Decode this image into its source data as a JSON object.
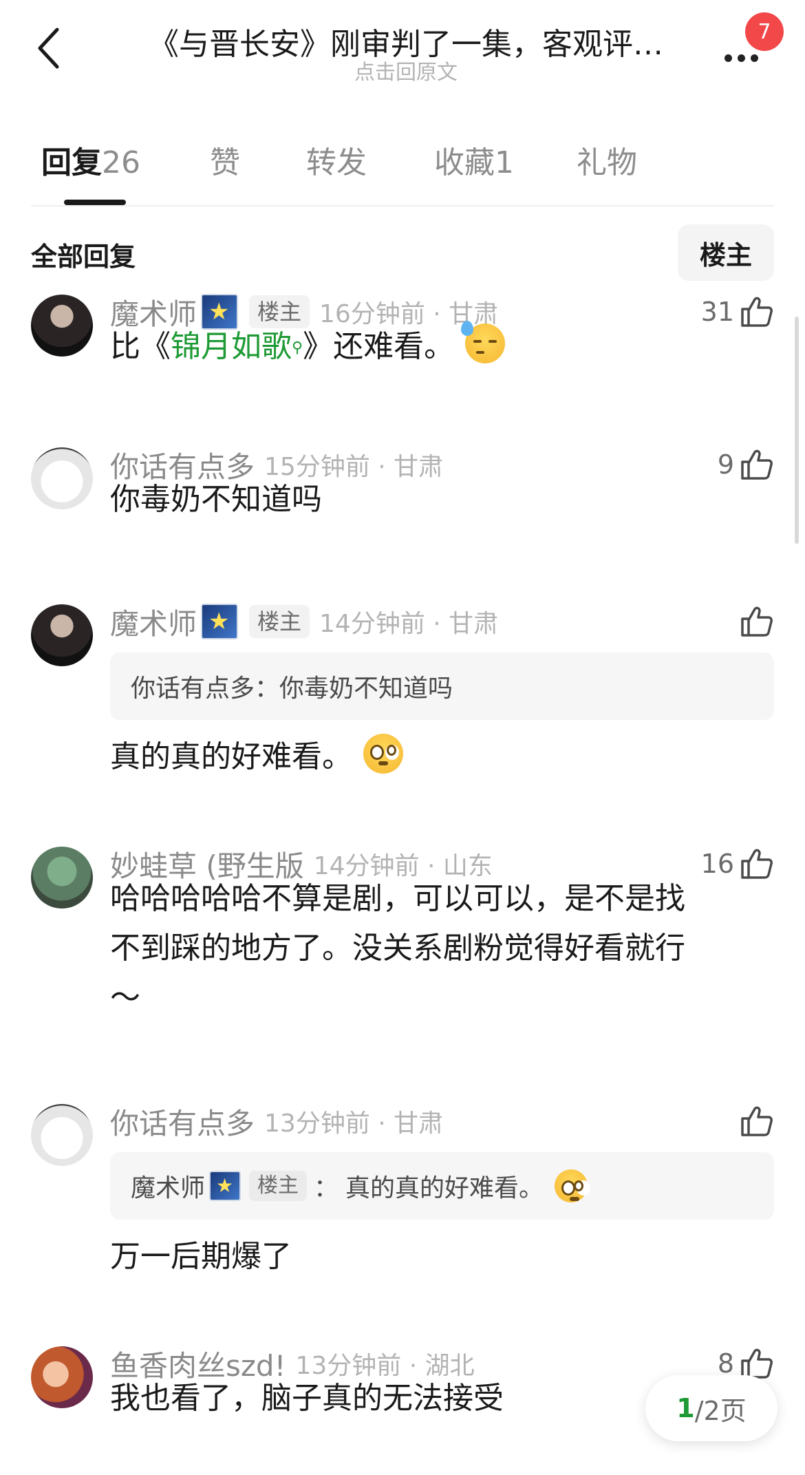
{
  "header": {
    "title": "《与晋长安》刚审判了一集，客观评…",
    "subtitle": "点击回原文",
    "badge_count": "7"
  },
  "tabs": [
    {
      "label": "回复",
      "count": "26",
      "active": true
    },
    {
      "label": "赞",
      "count": "",
      "active": false
    },
    {
      "label": "转发",
      "count": "",
      "active": false
    },
    {
      "label": "收藏",
      "count": "1",
      "active": false
    },
    {
      "label": "礼物",
      "count": "",
      "active": false
    }
  ],
  "section": {
    "title": "全部回复",
    "op_filter_label": "楼主"
  },
  "comments": [
    {
      "user": "魔术师",
      "op_tag": "楼主",
      "time": "16分钟前 · 甘肃",
      "likes": "31",
      "text_pre": "比《",
      "text_link": "锦月如歌",
      "text_post": "》还难看。"
    },
    {
      "user": "你话有点多",
      "time": "15分钟前 · 甘肃",
      "likes": "9",
      "text": "你毒奶不知道吗"
    },
    {
      "user": "魔术师",
      "op_tag": "楼主",
      "time": "14分钟前 · 甘肃",
      "likes": "",
      "quote": "你话有点多：你毒奶不知道吗",
      "text": "真的真的好难看。"
    },
    {
      "user": "妙蛙草 (野生版",
      "time": "14分钟前 · 山东",
      "likes": "16",
      "text_line1": "哈哈哈哈哈不算是剧，可以可以，是不是找",
      "text_line2": "不到踩的地方了。没关系剧粉觉得好看就行",
      "text_line3": "～"
    },
    {
      "user": "你话有点多",
      "time": "13分钟前 · 甘肃",
      "likes": "",
      "quote_user": "魔术师",
      "quote_tag": "楼主",
      "quote_sep": "：",
      "quote_text": "真的真的好难看。",
      "text": "万一后期爆了"
    },
    {
      "user": "鱼香肉丝szd!",
      "time": "13分钟前 · 湖北",
      "likes": "8",
      "text": "我也看了，脑子真的无法接受"
    }
  ],
  "pager": {
    "current": "1",
    "total": "/2页"
  },
  "colors": {
    "accent_green": "#1e9a35",
    "badge_red": "#f2484a"
  }
}
